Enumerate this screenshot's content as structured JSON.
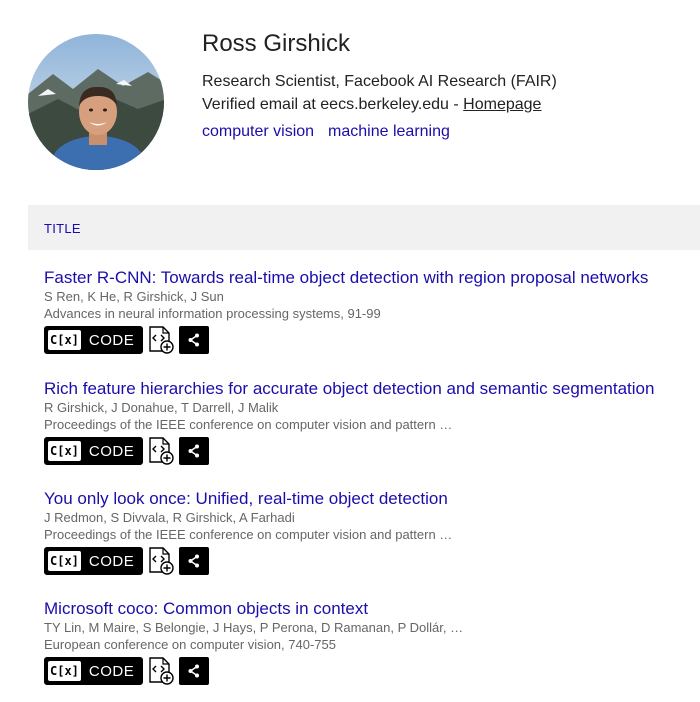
{
  "profile": {
    "name": "Ross Girshick",
    "affiliation": "Research Scientist, Facebook AI Research (FAIR)",
    "email_text": "Verified email at eecs.berkeley.edu - ",
    "homepage_label": "Homepage",
    "interests": [
      "computer vision",
      "machine learning"
    ]
  },
  "table": {
    "header_title": "TITLE"
  },
  "articles": [
    {
      "title": "Faster R-CNN: Towards real-time object detection with region proposal networks",
      "authors": "S Ren, K He, R Girshick, J Sun",
      "venue": "Advances in neural information processing systems, 91-99"
    },
    {
      "title": "Rich feature hierarchies for accurate object detection and semantic segmentation",
      "authors": "R Girshick, J Donahue, T Darrell, J Malik",
      "venue": "Proceedings of the IEEE conference on computer vision and pattern …"
    },
    {
      "title": "You only look once: Unified, real-time object detection",
      "authors": "J Redmon, S Divvala, R Girshick, A Farhadi",
      "venue": "Proceedings of the IEEE conference on computer vision and pattern …"
    },
    {
      "title": "Microsoft coco: Common objects in context",
      "authors": "TY Lin, M Maire, S Belongie, J Hays, P Perona, D Ramanan, P Dollár, …",
      "venue": "European conference on computer vision, 740-755"
    }
  ],
  "actions": {
    "cx_label": "C[x]",
    "code_label": "CODE"
  },
  "colors": {
    "link": "#1a0dab",
    "header_bg": "#f1f1f1",
    "meta_text": "#666666"
  }
}
